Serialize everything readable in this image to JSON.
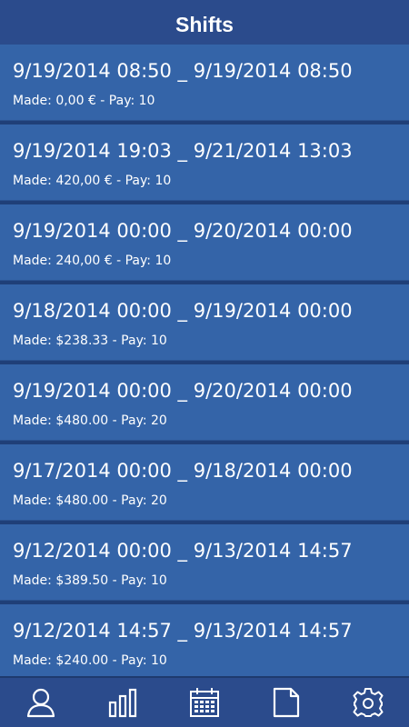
{
  "header": {
    "title": "Shifts"
  },
  "shifts": [
    {
      "range": "9/19/2014 08:50 _ 9/19/2014 08:50",
      "meta": "Made: 0,00 € - Pay: 10"
    },
    {
      "range": "9/19/2014 19:03 _ 9/21/2014 13:03",
      "meta": "Made: 420,00 € - Pay: 10"
    },
    {
      "range": "9/19/2014 00:00 _ 9/20/2014 00:00",
      "meta": "Made: 240,00 € - Pay: 10"
    },
    {
      "range": "9/18/2014 00:00 _ 9/19/2014 00:00",
      "meta": "Made: $238.33 - Pay: 10"
    },
    {
      "range": "9/19/2014 00:00 _ 9/20/2014 00:00",
      "meta": "Made: $480.00 - Pay: 20"
    },
    {
      "range": "9/17/2014 00:00 _ 9/18/2014 00:00",
      "meta": "Made: $480.00 - Pay: 20"
    },
    {
      "range": "9/12/2014 00:00 _ 9/13/2014 14:57",
      "meta": "Made: $389.50 - Pay: 10"
    },
    {
      "range": "9/12/2014 14:57 _ 9/13/2014 14:57",
      "meta": "Made: $240.00 - Pay: 10"
    }
  ],
  "nav": {
    "items": [
      {
        "icon": "user-icon"
      },
      {
        "icon": "bar-chart-icon"
      },
      {
        "icon": "calendar-icon"
      },
      {
        "icon": "document-icon"
      },
      {
        "icon": "gear-icon"
      }
    ]
  },
  "colors": {
    "header_bg": "#2b4b8c",
    "item_bg": "#3464a8",
    "text": "#ffffff"
  }
}
